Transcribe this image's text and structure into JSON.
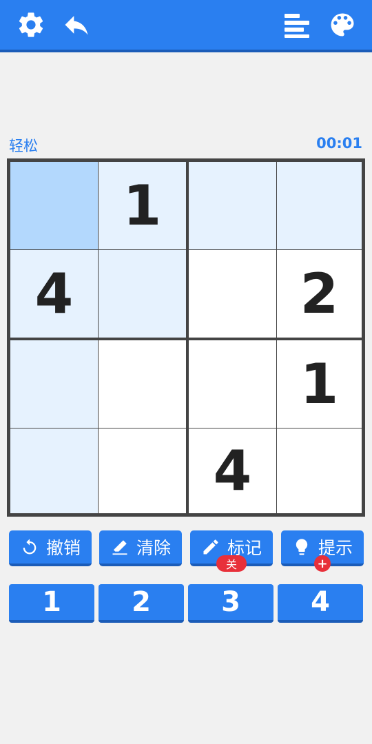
{
  "colors": {
    "accent": "#2a7ff0",
    "accent_dark": "#1b5cb8",
    "selected_cell": "#b3d8fd",
    "highlight_cell": "#e6f2fe",
    "plain_cell": "#ffffff",
    "badge": "#e8303a"
  },
  "toolbar": {
    "icons": [
      "gear-icon",
      "undo-arrow-icon",
      "stats-bars-icon",
      "palette-icon"
    ]
  },
  "game": {
    "difficulty": "轻松",
    "timer": "00:01"
  },
  "board": {
    "rows": [
      [
        {
          "value": "",
          "state": "selected"
        },
        {
          "value": "1",
          "state": "highlight"
        },
        {
          "value": "",
          "state": "highlight"
        },
        {
          "value": "",
          "state": "highlight"
        }
      ],
      [
        {
          "value": "4",
          "state": "highlight"
        },
        {
          "value": "",
          "state": "highlight"
        },
        {
          "value": "",
          "state": "plain"
        },
        {
          "value": "2",
          "state": "plain"
        }
      ],
      [
        {
          "value": "",
          "state": "highlight"
        },
        {
          "value": "",
          "state": "plain"
        },
        {
          "value": "",
          "state": "plain"
        },
        {
          "value": "1",
          "state": "plain"
        }
      ],
      [
        {
          "value": "",
          "state": "highlight"
        },
        {
          "value": "",
          "state": "plain"
        },
        {
          "value": "4",
          "state": "plain"
        },
        {
          "value": "",
          "state": "plain"
        }
      ]
    ]
  },
  "actions": {
    "undo": {
      "label": "撤销",
      "icon": "refresh-icon"
    },
    "erase": {
      "label": "清除",
      "icon": "eraser-icon"
    },
    "notes": {
      "label": "标记",
      "icon": "pencil-icon",
      "badge": "关"
    },
    "hint": {
      "label": "提示",
      "icon": "lightbulb-icon",
      "badge": "+"
    }
  },
  "numpad": [
    "1",
    "2",
    "3",
    "4"
  ]
}
